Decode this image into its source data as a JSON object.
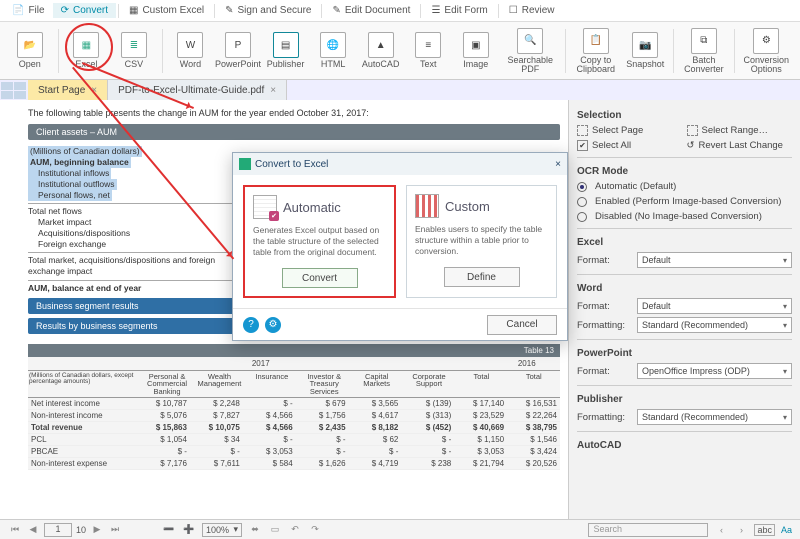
{
  "menu": {
    "file": "File",
    "convert": "Convert",
    "custom_excel": "Custom Excel",
    "sign_secure": "Sign and Secure",
    "edit_document": "Edit Document",
    "edit_form": "Edit Form",
    "review": "Review"
  },
  "ribbon": {
    "open": "Open",
    "excel": "Excel",
    "csv": "CSV",
    "word": "Word",
    "powerpoint": "PowerPoint",
    "publisher": "Publisher",
    "html": "HTML",
    "autocad": "AutoCAD",
    "text": "Text",
    "image": "Image",
    "searchable_pdf": "Searchable PDF",
    "copy_clip": "Copy to\nClipboard",
    "snapshot": "Snapshot",
    "batch": "Batch\nConverter",
    "conv_opts": "Conversion\nOptions"
  },
  "tabs": {
    "start": "Start Page",
    "doc": "PDF-to-Excel-Ultimate-Guide.pdf"
  },
  "doc": {
    "intro": "The following table presents the change in AUM for the year ended October 31, 2017:",
    "bar1": "Client assets – AUM",
    "sel_lines": [
      "(Millions of Canadian dollars)",
      "AUM, beginning balance",
      "Institutional inflows",
      "Institutional outflows",
      "Personal flows, net"
    ],
    "rows": [
      "Total net flows",
      "Market impact",
      "Acquisitions/dispositions",
      "Foreign exchange"
    ],
    "total_mkt": "Total market, acquisitions/dispositions and foreign exchange impact",
    "aum_end": "AUM, balance at end of year",
    "bluebar1": "Business segment results",
    "bluebar2": "Results by business segments",
    "t13": {
      "label": "Table 13",
      "year_cur": "2017",
      "year_prev": "2016",
      "cols": [
        "Personal & Commercial Banking",
        "Wealth Management",
        "Insurance",
        "Investor & Treasury Services",
        "Capital Markets",
        "Corporate Support",
        "Total",
        "Total"
      ],
      "note": "(Millions of Canadian dollars, except percentage amounts)",
      "rows": [
        {
          "l": "Net interest income",
          "v": [
            "10,787",
            "2,248",
            "-",
            "679",
            "3,565",
            "(139)",
            "17,140",
            "16,531"
          ]
        },
        {
          "l": "Non-interest income",
          "v": [
            "5,076",
            "7,827",
            "4,566",
            "1,756",
            "4,617",
            "(313)",
            "23,529",
            "22,264"
          ]
        },
        {
          "l": "Total revenue",
          "v": [
            "15,863",
            "10,075",
            "4,566",
            "2,435",
            "8,182",
            "(452)",
            "40,669",
            "38,795"
          ],
          "b": true
        },
        {
          "l": "PCL",
          "v": [
            "1,054",
            "34",
            "-",
            "-",
            "62",
            "-",
            "1,150",
            "1,546"
          ]
        },
        {
          "l": "PBCAE",
          "v": [
            "-",
            "-",
            "3,053",
            "-",
            "-",
            "-",
            "3,053",
            "3,424"
          ]
        },
        {
          "l": "Non-interest expense",
          "v": [
            "7,176",
            "7,611",
            "584",
            "1,626",
            "4,719",
            "238",
            "21,794",
            "20,526"
          ]
        }
      ]
    }
  },
  "side": {
    "selection_h": "Selection",
    "select_page": "Select Page",
    "select_range": "Select Range…",
    "select_all": "Select All",
    "revert": "Revert Last Change",
    "ocr_h": "OCR Mode",
    "ocr_auto": "Automatic (Default)",
    "ocr_enabled": "Enabled (Perform Image-based Conversion)",
    "ocr_disabled": "Disabled (No Image-based Conversion)",
    "excel_h": "Excel",
    "word_h": "Word",
    "ppt_h": "PowerPoint",
    "pub_h": "Publisher",
    "autocad_h": "AutoCAD",
    "format_l": "Format:",
    "formatting_l": "Formatting:",
    "default": "Default",
    "std_rec": "Standard (Recommended)",
    "ooi": "OpenOffice Impress (ODP)"
  },
  "dialog": {
    "title": "Convert to Excel",
    "auto_title": "Automatic",
    "auto_desc": "Generates Excel output based on the table structure of the selected table from the original document.",
    "custom_title": "Custom",
    "custom_desc": "Enables users to specify the table structure within a table prior to conversion.",
    "convert": "Convert",
    "define": "Define",
    "cancel": "Cancel"
  },
  "status": {
    "page": "1",
    "of": "10",
    "zoom": "100%",
    "search_ph": "Search"
  },
  "chart_data": {
    "type": "table",
    "title": "Table 13 – Results by business segments",
    "columns": [
      "Personal & Commercial Banking",
      "Wealth Management",
      "Insurance",
      "Investor & Treasury Services",
      "Capital Markets",
      "Corporate Support",
      "Total 2017",
      "Total 2016"
    ],
    "rows": [
      {
        "label": "Net interest income",
        "values": [
          10787,
          2248,
          0,
          679,
          3565,
          -139,
          17140,
          16531
        ]
      },
      {
        "label": "Non-interest income",
        "values": [
          5076,
          7827,
          4566,
          1756,
          4617,
          -313,
          23529,
          22264
        ]
      },
      {
        "label": "Total revenue",
        "values": [
          15863,
          10075,
          4566,
          2435,
          8182,
          -452,
          40669,
          38795
        ]
      },
      {
        "label": "PCL",
        "values": [
          1054,
          34,
          0,
          0,
          62,
          0,
          1150,
          1546
        ]
      },
      {
        "label": "PBCAE",
        "values": [
          0,
          0,
          3053,
          0,
          0,
          0,
          3053,
          3424
        ]
      },
      {
        "label": "Non-interest expense",
        "values": [
          7176,
          7611,
          584,
          1626,
          4719,
          238,
          21794,
          20526
        ]
      }
    ]
  }
}
